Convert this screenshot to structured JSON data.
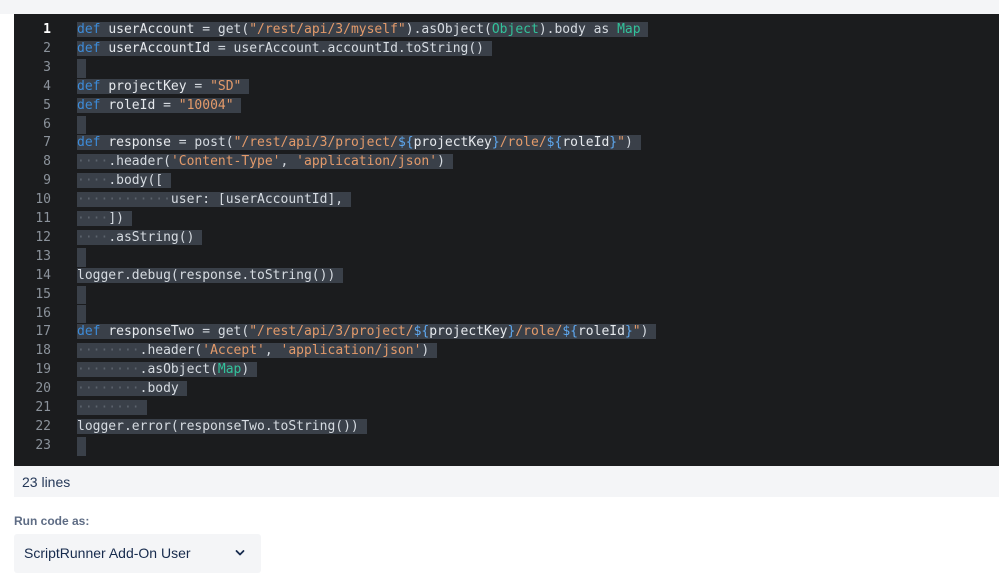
{
  "editor": {
    "active_line": 1,
    "lines": [
      {
        "n": "1",
        "tokens": [
          [
            "kw",
            "def"
          ],
          [
            "p",
            " "
          ],
          [
            "id",
            "userAccount"
          ],
          [
            "p",
            " = get("
          ],
          [
            "str",
            "\"/rest/api/3/myself\""
          ],
          [
            "p",
            ").asObject("
          ],
          [
            "type",
            "Object"
          ],
          [
            "p",
            ").body as "
          ],
          [
            "type",
            "Map"
          ]
        ]
      },
      {
        "n": "2",
        "tokens": [
          [
            "kw",
            "def"
          ],
          [
            "p",
            " "
          ],
          [
            "id",
            "userAccountId"
          ],
          [
            "p",
            " = userAccount.accountId.toString()"
          ]
        ]
      },
      {
        "n": "3",
        "tokens": []
      },
      {
        "n": "4",
        "tokens": [
          [
            "kw",
            "def"
          ],
          [
            "p",
            " "
          ],
          [
            "id",
            "projectKey"
          ],
          [
            "p",
            " = "
          ],
          [
            "str",
            "\"SD\""
          ]
        ]
      },
      {
        "n": "5",
        "tokens": [
          [
            "kw",
            "def"
          ],
          [
            "p",
            " "
          ],
          [
            "id",
            "roleId"
          ],
          [
            "p",
            " = "
          ],
          [
            "str",
            "\"10004\""
          ]
        ]
      },
      {
        "n": "6",
        "tokens": []
      },
      {
        "n": "7",
        "tokens": [
          [
            "kw",
            "def"
          ],
          [
            "p",
            " "
          ],
          [
            "id",
            "response"
          ],
          [
            "p",
            " = post("
          ],
          [
            "str",
            "\"/rest/api/3/project/"
          ],
          [
            "interp",
            "${"
          ],
          [
            "id",
            "projectKey"
          ],
          [
            "interp",
            "}"
          ],
          [
            "str",
            "/role/"
          ],
          [
            "interp",
            "${"
          ],
          [
            "id",
            "roleId"
          ],
          [
            "interp",
            "}"
          ],
          [
            "str",
            "\""
          ],
          [
            "p",
            ")"
          ]
        ]
      },
      {
        "n": "8",
        "tokens": [
          [
            "ws",
            "····"
          ],
          [
            "p",
            ".header("
          ],
          [
            "str",
            "'Content-Type'"
          ],
          [
            "p",
            ", "
          ],
          [
            "str",
            "'application/json'"
          ],
          [
            "p",
            ")"
          ]
        ]
      },
      {
        "n": "9",
        "tokens": [
          [
            "ws",
            "····"
          ],
          [
            "p",
            ".body(["
          ]
        ]
      },
      {
        "n": "10",
        "tokens": [
          [
            "ws",
            "············"
          ],
          [
            "p",
            "user: [userAccountId],"
          ]
        ]
      },
      {
        "n": "11",
        "tokens": [
          [
            "ws",
            "····"
          ],
          [
            "p",
            "])"
          ]
        ]
      },
      {
        "n": "12",
        "tokens": [
          [
            "ws",
            "····"
          ],
          [
            "p",
            ".asString()"
          ]
        ]
      },
      {
        "n": "13",
        "tokens": []
      },
      {
        "n": "14",
        "tokens": [
          [
            "p",
            "logger.debug(response.toString())"
          ]
        ]
      },
      {
        "n": "15",
        "tokens": []
      },
      {
        "n": "16",
        "tokens": []
      },
      {
        "n": "17",
        "tokens": [
          [
            "kw",
            "def"
          ],
          [
            "p",
            " "
          ],
          [
            "id",
            "responseTwo"
          ],
          [
            "p",
            " = get("
          ],
          [
            "str",
            "\"/rest/api/3/project/"
          ],
          [
            "interp",
            "${"
          ],
          [
            "id",
            "projectKey"
          ],
          [
            "interp",
            "}"
          ],
          [
            "str",
            "/role/"
          ],
          [
            "interp",
            "${"
          ],
          [
            "id",
            "roleId"
          ],
          [
            "interp",
            "}"
          ],
          [
            "str",
            "\""
          ],
          [
            "p",
            ")"
          ]
        ]
      },
      {
        "n": "18",
        "tokens": [
          [
            "ws",
            "········"
          ],
          [
            "p",
            ".header("
          ],
          [
            "str",
            "'Accept'"
          ],
          [
            "p",
            ", "
          ],
          [
            "str",
            "'application/json'"
          ],
          [
            "p",
            ")"
          ]
        ]
      },
      {
        "n": "19",
        "tokens": [
          [
            "ws",
            "········"
          ],
          [
            "p",
            ".asObject("
          ],
          [
            "type",
            "Map"
          ],
          [
            "p",
            ")"
          ]
        ]
      },
      {
        "n": "20",
        "tokens": [
          [
            "ws",
            "········"
          ],
          [
            "p",
            ".body"
          ]
        ]
      },
      {
        "n": "21",
        "tokens": [
          [
            "ws",
            "········"
          ]
        ]
      },
      {
        "n": "22",
        "tokens": [
          [
            "p",
            "logger.error(responseTwo.toString())"
          ]
        ]
      },
      {
        "n": "23",
        "tokens": []
      }
    ]
  },
  "footer": {
    "line_count_label": "23 lines"
  },
  "run_as": {
    "label": "Run code as:",
    "selected_value": "ScriptRunner Add-On User"
  },
  "icons": {
    "dropdown": "chevron-down-icon"
  },
  "colors": {
    "editor_background": "#1b1c1e",
    "keyword": "#3d8bd8",
    "string": "#e39a6a",
    "type": "#32c29a",
    "selection": "#3a4049"
  }
}
